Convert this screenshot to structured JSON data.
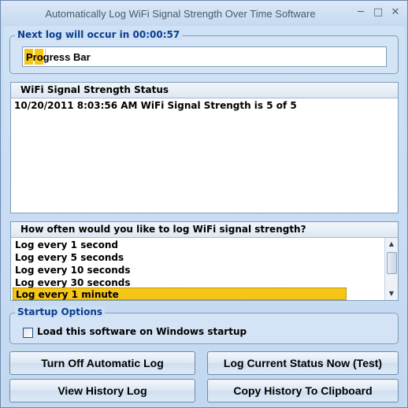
{
  "window": {
    "title": "Automatically Log WiFi Signal Strength Over Time Software",
    "min_glyph": "─",
    "max_glyph": "□",
    "close_glyph": "✕"
  },
  "next_log": {
    "label": "Next log will occur in 00:00:57",
    "progress_text": "Progress Bar",
    "progress_fraction": 0.06
  },
  "status_panel": {
    "header": "WiFi Signal Strength Status",
    "lines": [
      "10/20/2011 8:03:56 AM WiFi Signal Strength is 5 of 5"
    ]
  },
  "interval_panel": {
    "header": "How often would you like to log WiFi signal strength?",
    "options": [
      "Log every 1 second",
      "Log every 5 seconds",
      "Log every 10 seconds",
      "Log every 30 seconds",
      "Log every 1 minute"
    ],
    "selected_index": 4
  },
  "startup": {
    "label": "Startup Options",
    "checkbox_label": "Load this software on Windows startup",
    "checked": false
  },
  "buttons": {
    "turn_off": "Turn Off Automatic Log",
    "log_now": "Log Current Status Now (Test)",
    "view_history": "View History Log",
    "copy_history": "Copy History To Clipboard"
  },
  "colors": {
    "accent": "#f5c518",
    "group_title": "#0b3d91"
  },
  "icons": [
    "minimize-icon",
    "maximize-icon",
    "close-icon",
    "scroll-up-icon",
    "scroll-down-icon"
  ]
}
